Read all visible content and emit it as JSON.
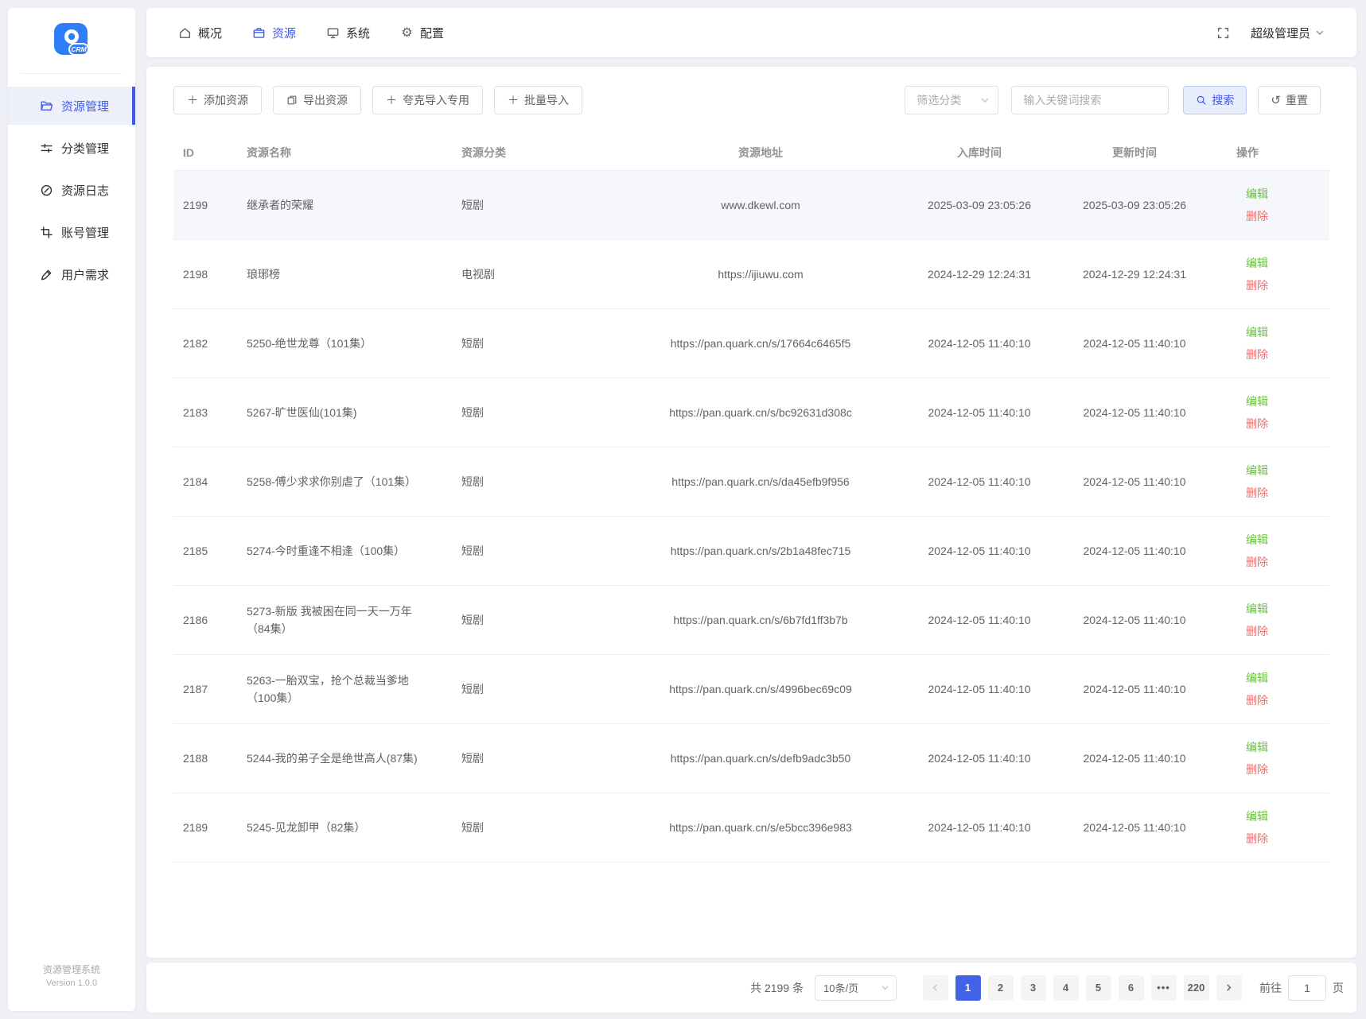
{
  "colors": {
    "accent": "#3e5be9",
    "logo_blue": "#2e7ef7",
    "green": "#67c23a",
    "red": "#f56c6c"
  },
  "app": {
    "logo_text": "CRM",
    "footer_line1": "资源管理系统",
    "footer_line2": "Version 1.0.0"
  },
  "topnav": {
    "items": [
      {
        "label": "概况"
      },
      {
        "label": "资源"
      },
      {
        "label": "系统"
      },
      {
        "label": "配置"
      }
    ],
    "user": "超级管理员"
  },
  "sidebar": {
    "items": [
      {
        "label": "资源管理"
      },
      {
        "label": "分类管理"
      },
      {
        "label": "资源日志"
      },
      {
        "label": "账号管理"
      },
      {
        "label": "用户需求"
      }
    ]
  },
  "toolbar": {
    "add_label": "添加资源",
    "export_label": "导出资源",
    "quark_label": "夸克导入专用",
    "batch_label": "批量导入",
    "filter_placeholder": "筛选分类",
    "keyword_placeholder": "输入关键词搜索",
    "search_label": "搜索",
    "reset_label": "重置"
  },
  "table": {
    "headers": {
      "id": "ID",
      "name": "资源名称",
      "category": "资源分类",
      "url": "资源地址",
      "created": "入库时间",
      "updated": "更新时间",
      "ops": "操作"
    },
    "edit_label": "编辑",
    "delete_label": "删除",
    "rows": [
      {
        "id": "2199",
        "name": "继承者的荣耀",
        "category": "短剧",
        "url": "www.dkewl.com",
        "created": "2025-03-09 23:05:26",
        "updated": "2025-03-09 23:05:26"
      },
      {
        "id": "2198",
        "name": "琅琊榜",
        "category": "电视剧",
        "url": "https://ijiuwu.com",
        "created": "2024-12-29 12:24:31",
        "updated": "2024-12-29 12:24:31"
      },
      {
        "id": "2182",
        "name": "5250-绝世龙尊（101集）",
        "category": "短剧",
        "url": "https://pan.quark.cn/s/17664c6465f5",
        "created": "2024-12-05 11:40:10",
        "updated": "2024-12-05 11:40:10"
      },
      {
        "id": "2183",
        "name": "5267-旷世医仙(101集)",
        "category": "短剧",
        "url": "https://pan.quark.cn/s/bc92631d308c",
        "created": "2024-12-05 11:40:10",
        "updated": "2024-12-05 11:40:10"
      },
      {
        "id": "2184",
        "name": "5258-傅少求求你别虐了（101集）",
        "category": "短剧",
        "url": "https://pan.quark.cn/s/da45efb9f956",
        "created": "2024-12-05 11:40:10",
        "updated": "2024-12-05 11:40:10"
      },
      {
        "id": "2185",
        "name": "5274-今时重逢不相逢（100集）",
        "category": "短剧",
        "url": "https://pan.quark.cn/s/2b1a48fec715",
        "created": "2024-12-05 11:40:10",
        "updated": "2024-12-05 11:40:10"
      },
      {
        "id": "2186",
        "name": "5273-新版 我被困在同一天一万年（84集）",
        "category": "短剧",
        "url": "https://pan.quark.cn/s/6b7fd1ff3b7b",
        "created": "2024-12-05 11:40:10",
        "updated": "2024-12-05 11:40:10"
      },
      {
        "id": "2187",
        "name": "5263-一胎双宝，抢个总裁当爹地（100集）",
        "category": "短剧",
        "url": "https://pan.quark.cn/s/4996bec69c09",
        "created": "2024-12-05 11:40:10",
        "updated": "2024-12-05 11:40:10"
      },
      {
        "id": "2188",
        "name": "5244-我的弟子全是绝世高人(87集)",
        "category": "短剧",
        "url": "https://pan.quark.cn/s/defb9adc3b50",
        "created": "2024-12-05 11:40:10",
        "updated": "2024-12-05 11:40:10"
      },
      {
        "id": "2189",
        "name": "5245-见龙卸甲（82集）",
        "category": "短剧",
        "url": "https://pan.quark.cn/s/e5bcc396e983",
        "created": "2024-12-05 11:40:10",
        "updated": "2024-12-05 11:40:10"
      }
    ]
  },
  "pagination": {
    "total": "共 2199 条",
    "page_size": "10条/页",
    "pages": [
      "1",
      "2",
      "3",
      "4",
      "5",
      "6"
    ],
    "more": "•••",
    "last_page": "220",
    "goto_label": "前往",
    "goto_value": "1",
    "goto_suffix": "页"
  }
}
